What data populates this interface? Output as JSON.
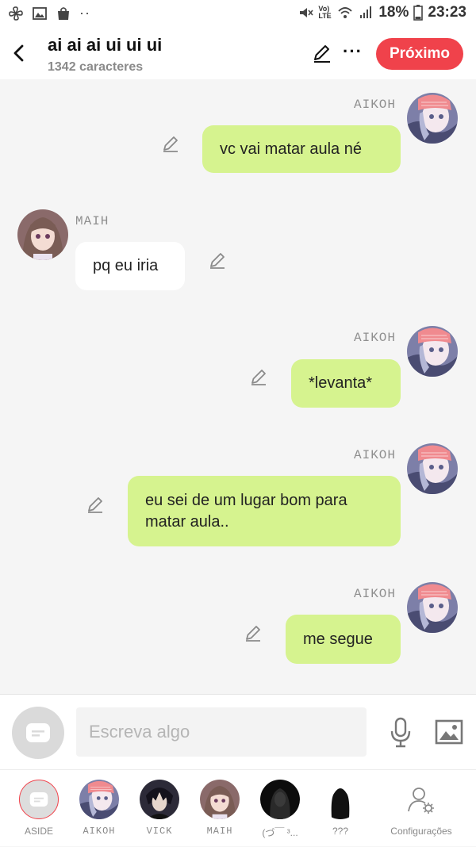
{
  "status_bar": {
    "battery": "18%",
    "time": "23:23",
    "network": "Vo) LTE"
  },
  "header": {
    "title": "ai ai ai ui ui ui",
    "subtitle": "1342 caracteres",
    "next_label": "Próximo"
  },
  "messages": [
    {
      "sender": "AIKOH",
      "side": "right",
      "text": "vc vai matar aula né"
    },
    {
      "sender": "MAIH",
      "side": "left",
      "text": "pq eu iria"
    },
    {
      "sender": "AIKOH",
      "side": "right",
      "text": "*levanta*"
    },
    {
      "sender": "AIKOH",
      "side": "right",
      "text": "eu sei de um lugar bom para matar aula.."
    },
    {
      "sender": "AIKOH",
      "side": "right",
      "text": "me segue"
    }
  ],
  "compose": {
    "placeholder": "Escreva algo"
  },
  "characters": [
    {
      "label": "ASIDE"
    },
    {
      "label": "AIKOH"
    },
    {
      "label": "VICK"
    },
    {
      "label": "MAIH"
    },
    {
      "label": "(づ￣ ³..."
    },
    {
      "label": "???"
    },
    {
      "label": "Configurações"
    }
  ],
  "colors": {
    "accent": "#f0424b",
    "my_bubble": "#d6f38f",
    "their_bubble": "#ffffff",
    "background": "#f5f5f5"
  }
}
